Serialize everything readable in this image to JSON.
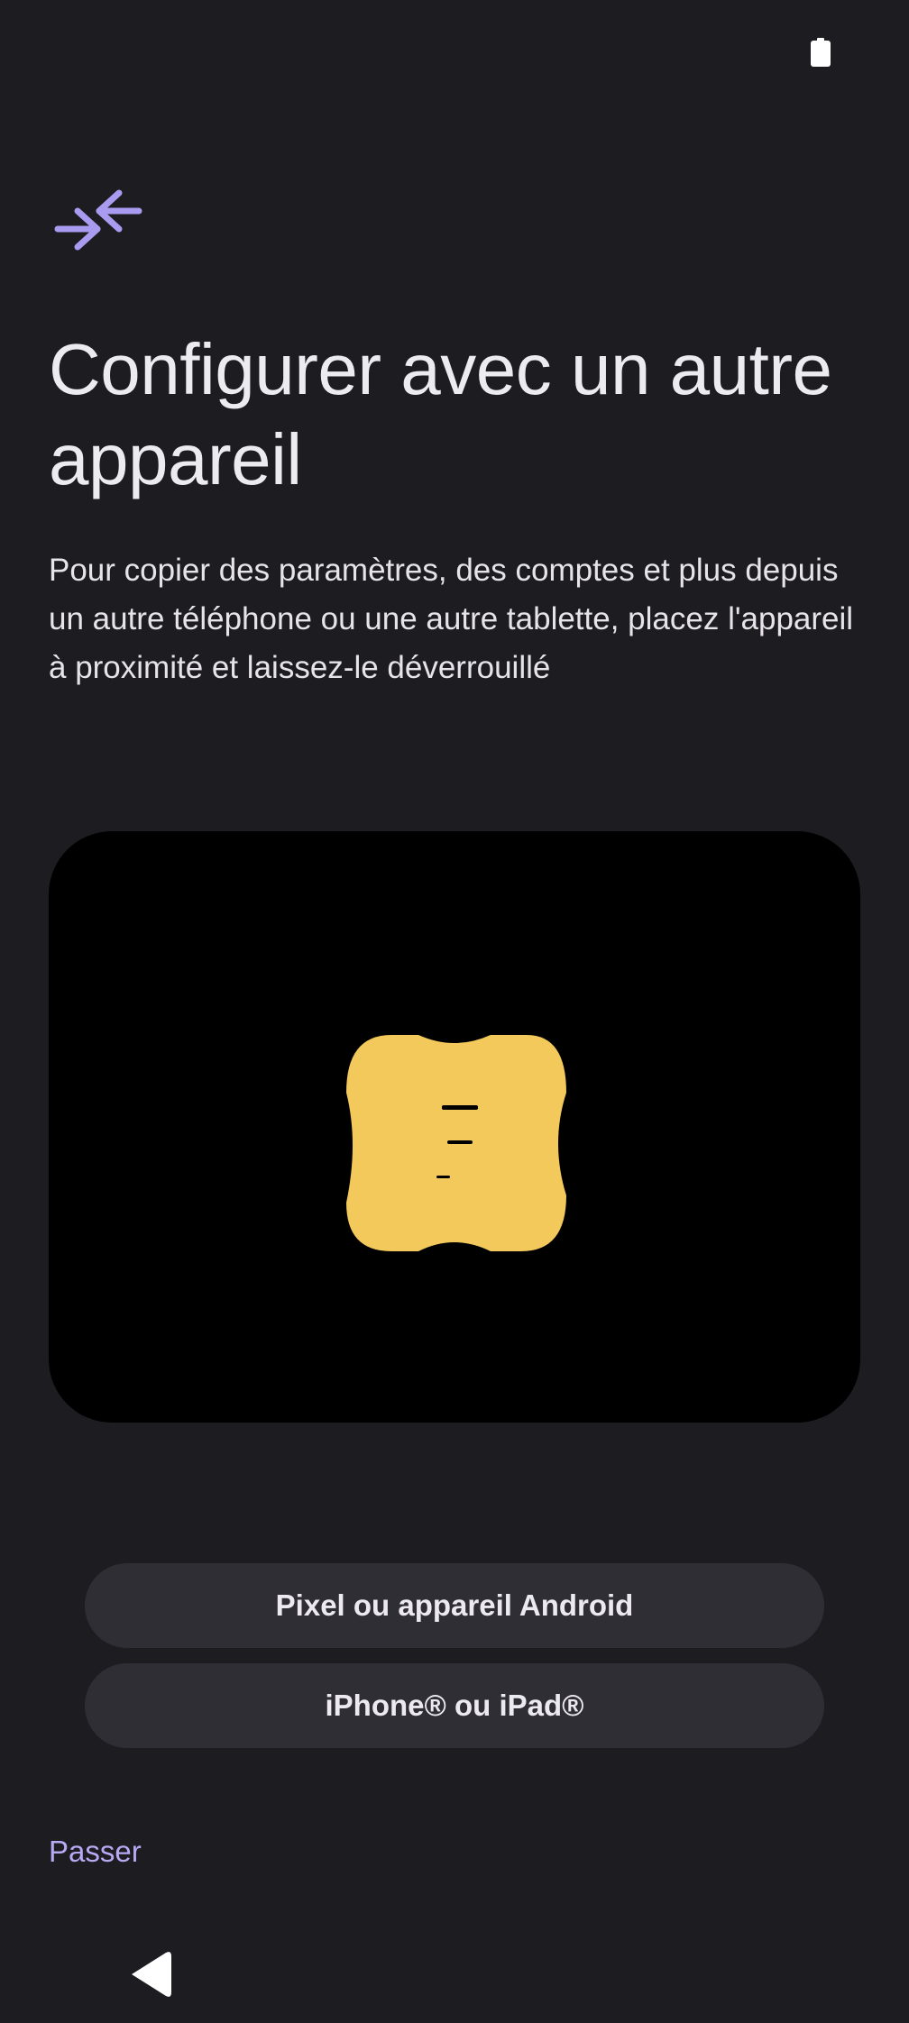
{
  "status_bar": {
    "battery_icon": "battery-icon"
  },
  "header": {
    "icon": "compress-arrows-icon",
    "title": "Configurer avec un autre appareil",
    "description": "Pour copier des paramètres, des comptes et plus depuis un autre téléphone ou une autre tablette, placez l'appareil à proximité et laissez-le déverrouillé"
  },
  "illustration": {
    "icon": "device-transfer-illustration",
    "shape_color": "#f2c95a",
    "background_color": "#000000"
  },
  "options": {
    "android_label": "Pixel ou appareil Android",
    "apple_label": "iPhone® ou iPad®"
  },
  "footer": {
    "skip_label": "Passer"
  },
  "nav": {
    "back_icon": "back-triangle-icon"
  },
  "colors": {
    "background": "#1d1c21",
    "accent": "#b8a9f3",
    "button_bg": "#2f2e35",
    "text": "#eceaf0"
  }
}
